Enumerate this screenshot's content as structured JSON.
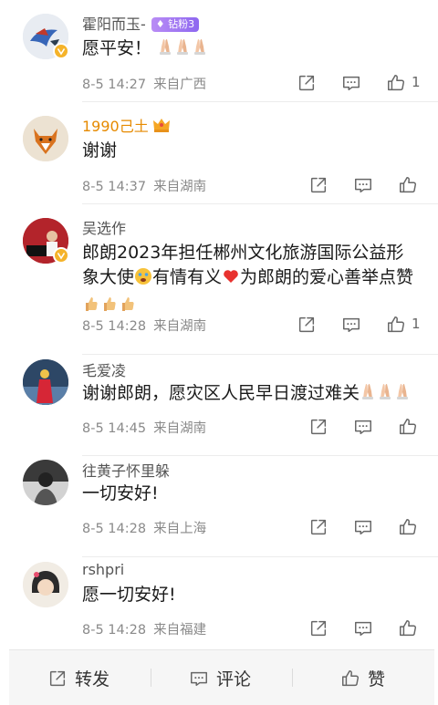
{
  "comments": [
    {
      "username": "霍阳而玉-",
      "badge": "钻粉3",
      "text": "愿平安！",
      "date": "8-5 14:27",
      "location": "来自广西",
      "likes": "1"
    },
    {
      "username": "1990己土",
      "text": "谢谢",
      "date": "8-5 14:37",
      "location": "来自湖南",
      "likes": ""
    },
    {
      "username": "吴选作",
      "text_line1": "郎朗2023年担任郴州文化旅游国际公益形",
      "text_line2a": "象大使",
      "text_line2b": "有情有义",
      "text_line2c": "为郎朗的爱心善举点赞",
      "date": "8-5 14:28",
      "location": "来自湖南",
      "likes": "1"
    },
    {
      "username": "毛爱凌",
      "text": "谢谢郎朗，愿灾区人民早日渡过难关",
      "date": "8-5 14:45",
      "location": "来自湖南",
      "likes": ""
    },
    {
      "username": "往黄子怀里躲",
      "text": "一切安好!",
      "date": "8-5 14:28",
      "location": "来自上海",
      "likes": ""
    },
    {
      "username": "rshpri",
      "text": "愿一切安好!",
      "date": "8-5 14:28",
      "location": "来自福建",
      "likes": ""
    }
  ],
  "bottom_bar": {
    "repost_label": "转发",
    "comment_label": "评论",
    "like_label": "赞"
  },
  "icons": {
    "share": "share-icon",
    "comment": "comment-icon",
    "like": "thumbs-up-icon",
    "pray": "folded-hands-icon",
    "verified": "verified-badge-icon"
  },
  "colors": {
    "verified": "#f5b32a",
    "gold_name": "#e68a00",
    "badge": "#8e68f0"
  }
}
